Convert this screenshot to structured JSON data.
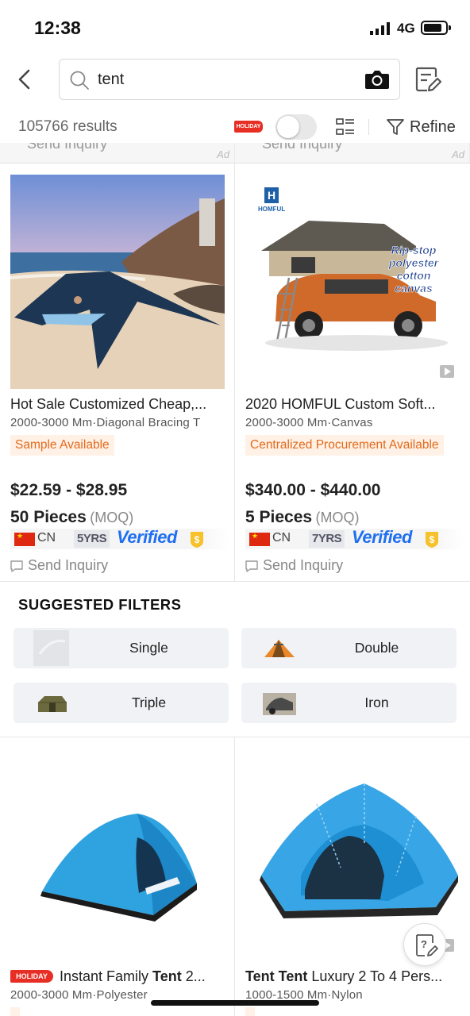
{
  "status_bar": {
    "time": "12:38",
    "network": "4G"
  },
  "search": {
    "query": "tent"
  },
  "results_bar": {
    "count": "105766 results",
    "holiday_badge": "HOLIDAY",
    "refine_label": "Refine"
  },
  "prev_row": {
    "inquiry_label": "Send Inquiry",
    "ad_label": "Ad"
  },
  "products": [
    {
      "title": "Hot Sale Customized Cheap,...",
      "attrs": "2000-3000 Mm·Diagonal Bracing T",
      "tag": "Sample Available",
      "price": "$22.59 - $28.95",
      "moq_qty": "50 Pieces",
      "moq_label": "(MOQ)",
      "country": "CN",
      "years": "5YRS",
      "verified": "Verified",
      "inquiry": "Send Inquiry"
    },
    {
      "title": "2020 HOMFUL Custom Soft...",
      "attrs": "2000-3000 Mm·Canvas",
      "tag": "Centralized Procurement Available",
      "price": "$340.00 - $440.00",
      "moq_qty": "5 Pieces",
      "moq_label": "(MOQ)",
      "country": "CN",
      "years": "7YRS",
      "verified": "Verified",
      "inquiry": "Send Inquiry",
      "image_brand": "HOMFUL",
      "image_caption": [
        "Rip-stop",
        "polyester",
        "cotton",
        "canvas"
      ]
    },
    {
      "holiday_tag": "HOLIDAY",
      "title_prefix": "Instant Family ",
      "title_bold": "Tent",
      "title_suffix": " 2...",
      "attrs": "2000-3000 Mm·Polyester"
    },
    {
      "title_bold": "Tent Tent",
      "title_suffix": " Luxury 2 To 4 Pers...",
      "attrs": "1000-1500 Mm·Nylon"
    }
  ],
  "suggested_filters": {
    "title": "SUGGESTED FILTERS",
    "items": [
      {
        "label": "Single"
      },
      {
        "label": "Double"
      },
      {
        "label": "Triple"
      },
      {
        "label": "Iron"
      }
    ]
  },
  "colors": {
    "accent_orange": "#e46a1b",
    "verified_blue": "#1f6ff0",
    "holiday_red": "#e62e24"
  }
}
